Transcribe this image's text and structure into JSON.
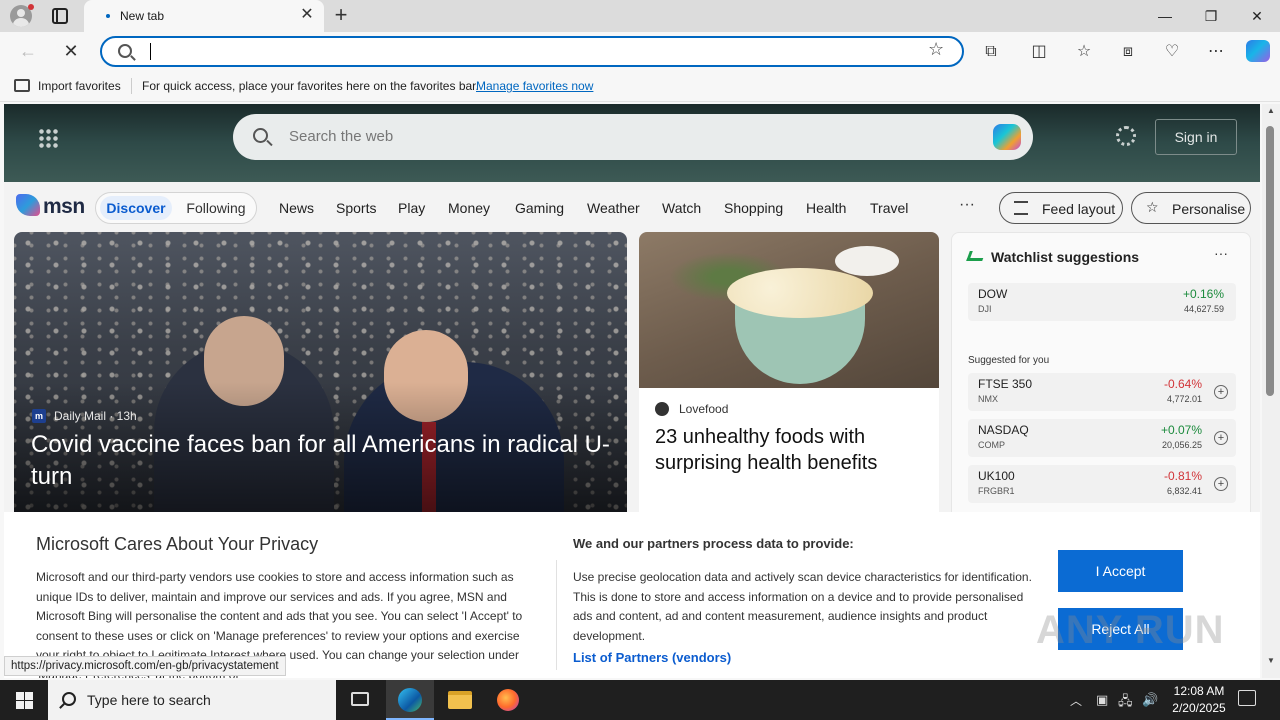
{
  "browser": {
    "tab_title": "New tab",
    "address_value": "",
    "favorites_bar": {
      "import_label": "Import favorites",
      "hint": "For quick access, place your favorites here on the favorites bar.",
      "manage_link": "Manage favorites now"
    },
    "status_url": "https://privacy.microsoft.com/en-gb/privacystatement"
  },
  "msn": {
    "search_placeholder": "Search the web",
    "sign_in": "Sign in",
    "logo_text": "msn",
    "segments": [
      "Discover",
      "Following"
    ],
    "nav_links": [
      "News",
      "Sports",
      "Play",
      "Money",
      "Gaming",
      "Weather",
      "Watch",
      "Shopping",
      "Health",
      "Travel"
    ],
    "more": "···",
    "feed_layout": "Feed layout",
    "personalise": "Personalise",
    "hero": {
      "source_logo": "m",
      "source": "Daily Mail · 13h",
      "title": "Covid vaccine faces ban for all Americans in radical U-turn"
    },
    "food": {
      "source": "Lovefood",
      "title": "23 unhealthy foods with surprising health benefits"
    },
    "watchlist": {
      "title": "Watchlist suggestions",
      "more": "···",
      "suggested_label": "Suggested for you",
      "stocks": [
        {
          "name": "DOW",
          "code": "DJI",
          "change": "+0.16%",
          "value": "44,627.59",
          "direction": "up",
          "addable": false
        },
        {
          "name": "FTSE 350",
          "code": "NMX",
          "change": "-0.64%",
          "value": "4,772.01",
          "direction": "down",
          "addable": true
        },
        {
          "name": "NASDAQ",
          "code": "COMP",
          "change": "+0.07%",
          "value": "20,056.25",
          "direction": "up",
          "addable": true
        },
        {
          "name": "UK100",
          "code": "FRGBR1",
          "change": "-0.81%",
          "value": "6,832.41",
          "direction": "down",
          "addable": true
        }
      ]
    }
  },
  "privacy": {
    "title": "Microsoft Cares About Your Privacy",
    "body": "Microsoft and our third-party vendors use cookies to store and access information such as unique IDs to deliver, maintain and improve our services and ads. If you agree, MSN and Microsoft Bing will personalise the content and ads that you see. You can select 'I Accept' to consent to these uses or click on 'Manage preferences' to review your options and exercise your right to object to Legitimate Interest where used. You can change your selection under 'Manage Preferences' at the bottom of",
    "subtitle": "We and our partners process data to provide:",
    "body2": "Use precise geolocation data and actively scan device characteristics for identification. This is done to store and access information on a device and to provide personalised ads and content, ad and content measurement, audience insights and product development.",
    "partners_link": "List of Partners (vendors)",
    "accept": "I Accept",
    "reject": "Reject All"
  },
  "watermark": "ANY RUN",
  "taskbar": {
    "search_placeholder": "Type here to search",
    "time": "12:08 AM",
    "date": "2/20/2025"
  },
  "colors": {
    "accent": "#0067c0",
    "positive": "#1b8a3c",
    "negative": "#d13438",
    "button_blue": "#0b6bd3"
  }
}
